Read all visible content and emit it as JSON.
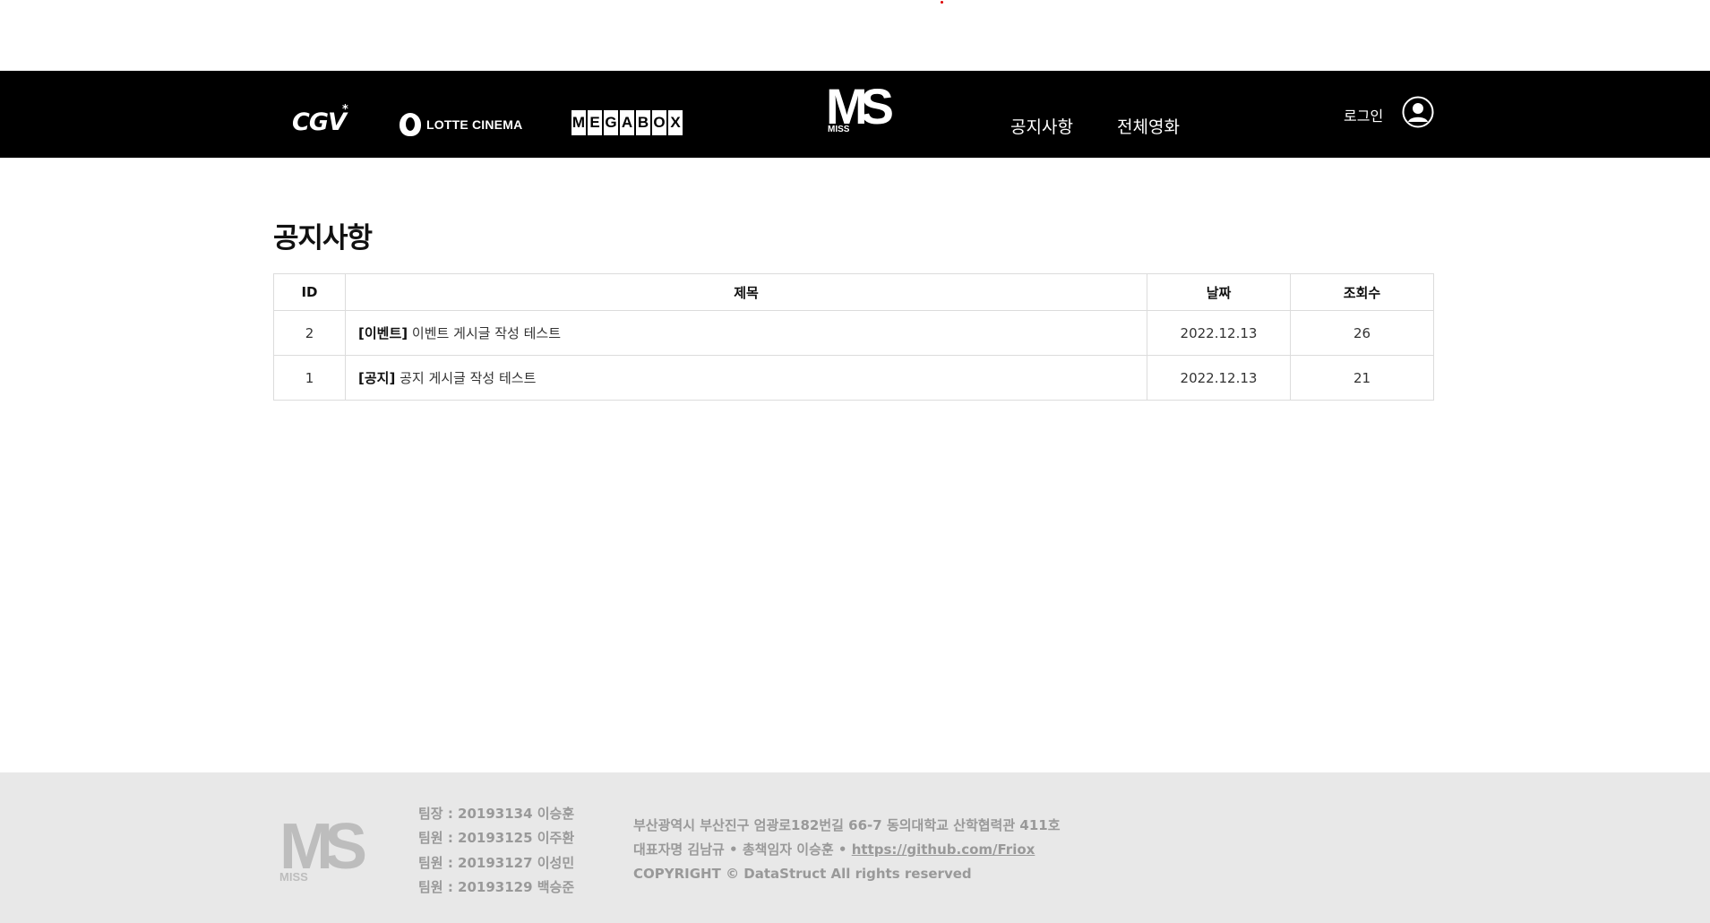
{
  "header": {
    "brands": {
      "cgv": "CGV",
      "cgv_mark": "*",
      "lotte": "LOTTE CINEMA",
      "megabox": [
        "M",
        "E",
        "G",
        "A",
        "B",
        "O",
        "X"
      ]
    },
    "logo": {
      "main": "MS",
      "sub": "MISS"
    },
    "nav": {
      "notice": "공지사항",
      "movies": "전체영화"
    },
    "login": "로그인"
  },
  "main": {
    "title": "공지사항",
    "table": {
      "headers": {
        "id": "ID",
        "title": "제목",
        "date": "날짜",
        "views": "조회수"
      },
      "rows": [
        {
          "id": "2",
          "category": "[이벤트]",
          "title": "이벤트 게시글 작성 테스트",
          "date": "2022.12.13",
          "views": "26"
        },
        {
          "id": "1",
          "category": "[공지]",
          "title": "공지 게시글 작성 테스트",
          "date": "2022.12.13",
          "views": "21"
        }
      ]
    }
  },
  "footer": {
    "logo": {
      "main": "MS",
      "sub": "MISS"
    },
    "members": [
      "팀장 : 20193134 이승훈",
      "팀원 : 20193125 이주환",
      "팀원 : 20193127 이성민",
      "팀원 : 20193129 백승준"
    ],
    "address": "부산광역시 부산진구 엄광로182번길 66-7 동의대학교 산학협력관 411호",
    "contact_prefix": "대표자명 김남규 • 총책임자 이승훈 •",
    "link": "https://github.com/Friox",
    "copyright": "COPYRIGHT © DataStruct All rights reserved"
  },
  "icons": {
    "user": "user-circle-icon"
  },
  "colors": {
    "header_bg": "#000000",
    "footer_bg": "#e8e8e8",
    "footer_text": "#999999",
    "border": "#dcdcdc"
  }
}
